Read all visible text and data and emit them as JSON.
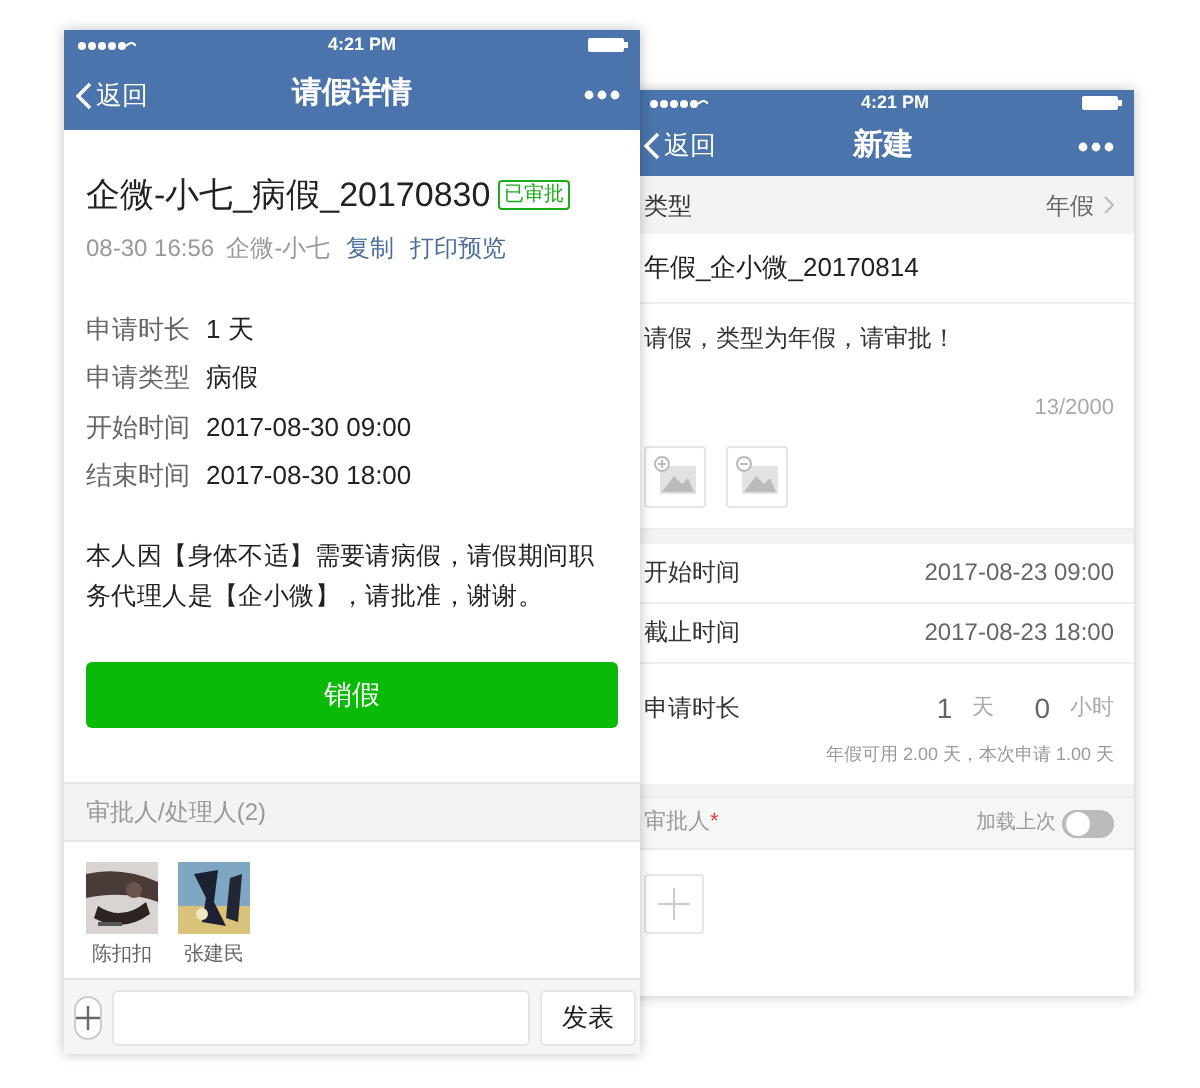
{
  "detail_screen": {
    "status_bar": {
      "time": "4:21 PM"
    },
    "nav": {
      "back": "返回",
      "title": "请假详情"
    },
    "title": "企微-小七_病假_20170830",
    "badge": "已审批",
    "meta": {
      "time": "08-30 16:56",
      "author": "企微-小七",
      "links": [
        "复制",
        "打印预览"
      ]
    },
    "fields": [
      {
        "label": "申请时长",
        "value": "1 天"
      },
      {
        "label": "申请类型",
        "value": "病假"
      },
      {
        "label": "开始时间",
        "value": "2017-08-30 09:00"
      },
      {
        "label": "结束时间",
        "value": "2017-08-30 18:00"
      }
    ],
    "reason": "本人因【身体不适】需要请病假，请假期间职务代理人是【企小微】，请批准，谢谢。",
    "action_button": "销假",
    "approvers_header": "审批人/处理人(2)",
    "approvers": [
      {
        "name": "陈扣扣",
        "kind": "picture"
      },
      {
        "name": "张建民",
        "kind": "picture"
      }
    ],
    "composer": {
      "send": "发表"
    }
  },
  "new_screen": {
    "status_bar": {
      "time": "4:21 PM"
    },
    "nav": {
      "back": "返回",
      "title": "新建"
    },
    "type_row": {
      "label": "类型",
      "value": "年假"
    },
    "title": "年假_企小微_20170814",
    "description": "请假，类型为年假，请审批！",
    "counter": "13/2000",
    "times": [
      {
        "label": "开始时间",
        "value": "2017-08-23 09:00"
      },
      {
        "label": "截止时间",
        "value": "2017-08-23 18:00"
      }
    ],
    "duration": {
      "label": "申请时长",
      "days": "1",
      "days_unit": "天",
      "hours": "0",
      "hours_unit": "小时",
      "note": "年假可用 2.00 天，本次申请 1.00 天"
    },
    "approver": {
      "label": "审批人",
      "required_mark": "*",
      "load_last": "加载上次",
      "load_last_on": false
    }
  }
}
